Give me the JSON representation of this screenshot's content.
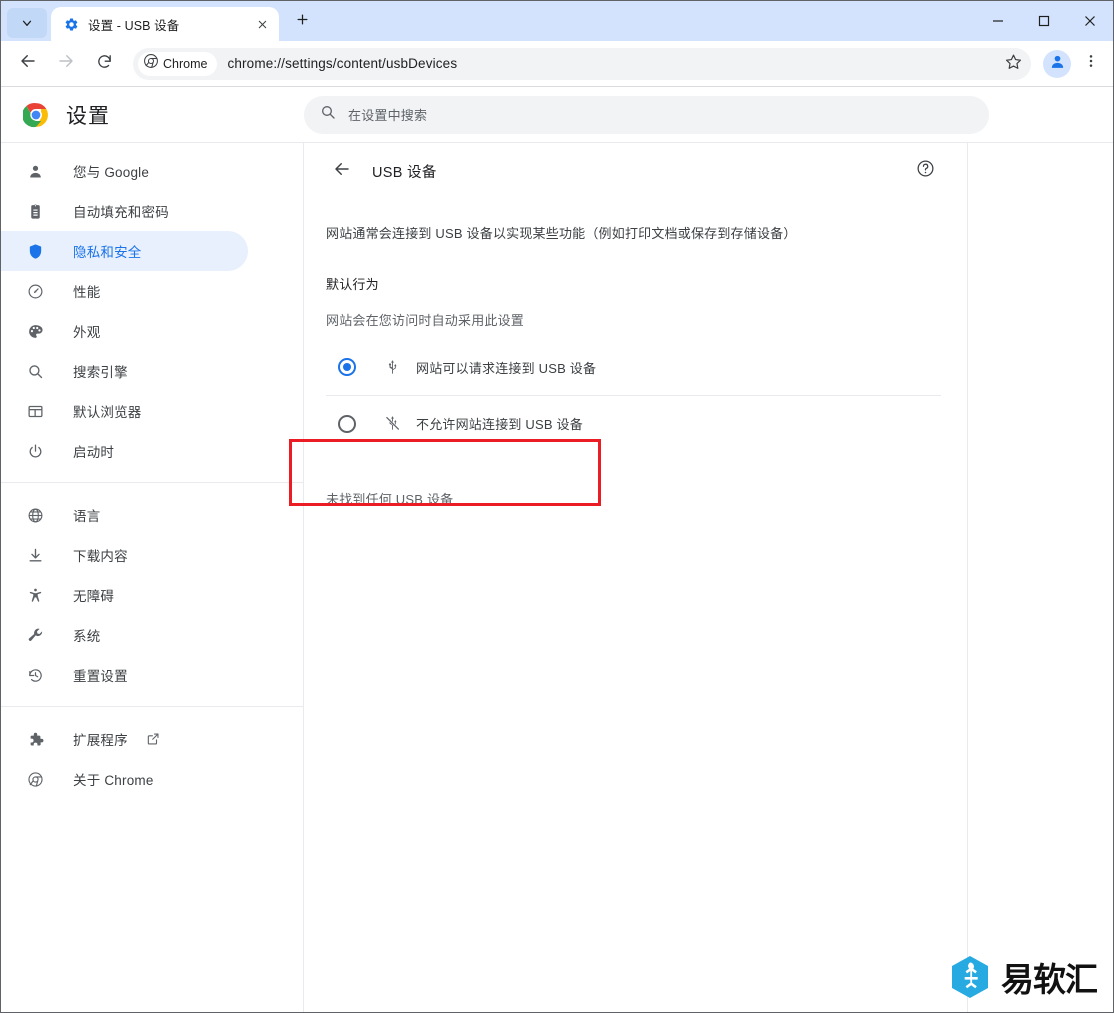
{
  "window": {
    "tab_search_icon": "chevron-down-icon",
    "minimize_label": "—",
    "maximize_label": "□",
    "close_label": "✕",
    "new_tab_label": "+"
  },
  "tab": {
    "title": "设置 - USB 设备",
    "favicon": "gear-icon",
    "close_label": "✕"
  },
  "toolbar": {
    "back_icon": "arrow-left-icon",
    "forward_icon": "arrow-right-icon",
    "reload_icon": "reload-icon",
    "chip_label": "Chrome",
    "url": "chrome://settings/content/usbDevices",
    "star_icon": "star-icon",
    "profile_icon": "account-icon",
    "menu_icon": "three-dot-menu-icon"
  },
  "settings_header": {
    "logo": "chrome-logo",
    "title": "设置",
    "search_placeholder": "在设置中搜索",
    "search_value": "",
    "search_icon": "search-icon"
  },
  "sidebar": {
    "groups": [
      {
        "items": [
          {
            "label": "您与 Google",
            "icon": "person-icon",
            "selected": false
          },
          {
            "label": "自动填充和密码",
            "icon": "clipboard-icon",
            "selected": false
          },
          {
            "label": "隐私和安全",
            "icon": "shield-icon",
            "selected": true
          },
          {
            "label": "性能",
            "icon": "speedometer-icon",
            "selected": false
          },
          {
            "label": "外观",
            "icon": "palette-icon",
            "selected": false
          },
          {
            "label": "搜索引擎",
            "icon": "search-icon",
            "selected": false
          },
          {
            "label": "默认浏览器",
            "icon": "browser-window-icon",
            "selected": false
          },
          {
            "label": "启动时",
            "icon": "power-icon",
            "selected": false
          }
        ]
      },
      {
        "items": [
          {
            "label": "语言",
            "icon": "globe-icon",
            "selected": false
          },
          {
            "label": "下载内容",
            "icon": "download-icon",
            "selected": false
          },
          {
            "label": "无障碍",
            "icon": "accessibility-icon",
            "selected": false
          },
          {
            "label": "系统",
            "icon": "wrench-icon",
            "selected": false
          },
          {
            "label": "重置设置",
            "icon": "history-restore-icon",
            "selected": false
          }
        ]
      },
      {
        "items": [
          {
            "label": "扩展程序",
            "icon": "puzzle-icon",
            "selected": false,
            "external": true
          },
          {
            "label": "关于 Chrome",
            "icon": "chrome-icon",
            "selected": false
          }
        ]
      }
    ]
  },
  "main": {
    "back_icon": "arrow-left-icon",
    "title": "USB 设备",
    "help_icon": "help-circle-icon",
    "description": "网站通常会连接到 USB 设备以实现某些功能（例如打印文档或保存到存储设备）",
    "section_title": "默认行为",
    "section_subtitle": "网站会在您访问时自动采用此设置",
    "options": [
      {
        "label": "网站可以请求连接到 USB 设备",
        "icon": "usb-icon",
        "selected": true
      },
      {
        "label": "不允许网站连接到 USB 设备",
        "icon": "usb-off-icon",
        "selected": false
      }
    ],
    "empty_note": "未找到任何 USB 设备"
  },
  "annotation": {
    "highlight_color": "#ec1c24",
    "target": "网站可以请求连接到 USB 设备"
  },
  "watermark": {
    "text": "易软汇",
    "mark_color": "#27aae1"
  },
  "colors": {
    "accent": "#1a73e8",
    "selected_bg": "#e8f0fe",
    "titlebar": "#d3e3fd",
    "omnibox": "#f1f3f4"
  }
}
